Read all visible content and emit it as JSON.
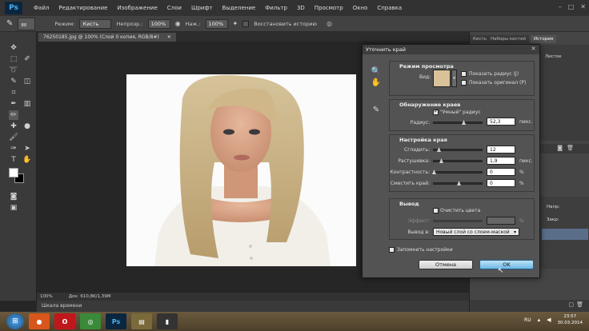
{
  "app": {
    "logo": "Ps",
    "menu": [
      "Файл",
      "Редактирование",
      "Изображение",
      "Слои",
      "Шрифт",
      "Выделение",
      "Фильтр",
      "3D",
      "Просмотр",
      "Окно",
      "Справка"
    ]
  },
  "options_bar": {
    "size_value": "80",
    "mode_label": "Режим:",
    "mode_value": "Кисть",
    "opacity_label": "Непрозр.:",
    "opacity_value": "100%",
    "pressure_label": "Наж.:",
    "pressure_value": "100%",
    "restore_label": "Восстановить историю"
  },
  "document": {
    "tab_title": "76250185.jpg @ 100% (Слой 0 копия, RGB/8#)",
    "zoom": "100%",
    "doc_info": "Док: 610,8K/1,39M",
    "timeline_label": "Шкала времени"
  },
  "right_panels": {
    "tabs": [
      "Кисть",
      "Наборы кистей",
      "История"
    ],
    "peek_labels": [
      "Листок",
      "Напр:",
      "Закр:"
    ]
  },
  "dialog": {
    "title": "Уточнить край",
    "view_mode": {
      "title": "Режим просмотра",
      "view_label": "Вид:",
      "show_radius": "Показать радиус (J)",
      "show_original": "Показать оригинал (P)"
    },
    "edge_detection": {
      "title": "Обнаружение краев",
      "smart_radius": "\"Умный\" радиус",
      "radius_label": "Радиус:",
      "radius_value": "52,3",
      "radius_unit": "пикс."
    },
    "adjust_edge": {
      "title": "Настройка края",
      "smooth_label": "Сгладить:",
      "smooth_value": "12",
      "feather_label": "Растушевка:",
      "feather_value": "1,9",
      "feather_unit": "пикс.",
      "contrast_label": "Контрастность:",
      "contrast_value": "0",
      "contrast_unit": "%",
      "shift_label": "Сместить край:",
      "shift_value": "0",
      "shift_unit": "%"
    },
    "output": {
      "title": "Вывод",
      "decontaminate": "Очистить цвета",
      "amount_label": "Эффект:",
      "amount_unit": "%",
      "output_to_label": "Вывод в:",
      "output_to_value": "Новый слой со слоем-маской"
    },
    "remember": "Запомнить настройки",
    "cancel": "Отмена",
    "ok": "OK"
  },
  "taskbar": {
    "tray_lang": "RU",
    "time": "23:57",
    "date": "30.03.2014"
  },
  "colors": {
    "ps_blue": "#4ab0f5",
    "ok_blue": "#6fb7e3"
  }
}
